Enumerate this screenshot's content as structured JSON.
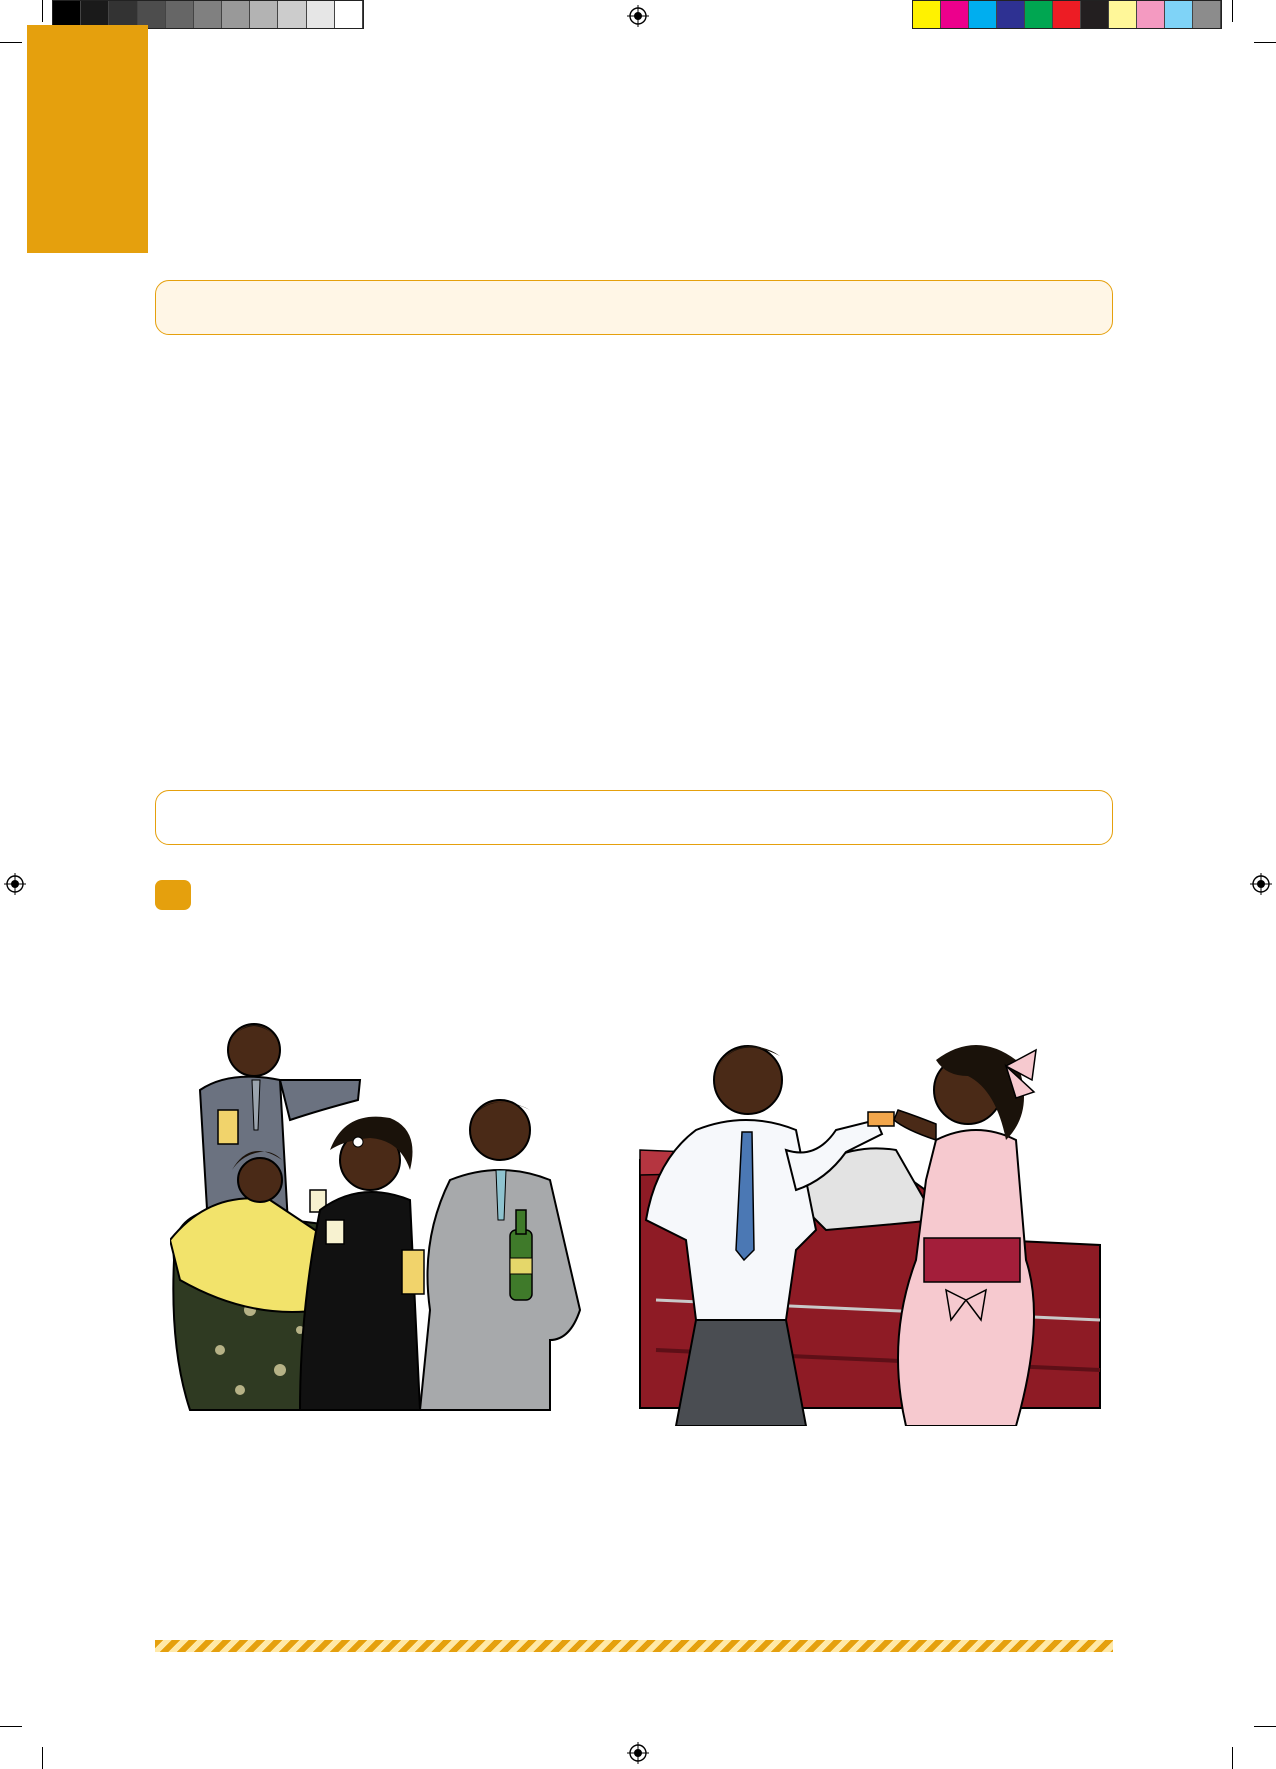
{
  "page": {
    "accent_color": "#E5A00D",
    "box_fill_color": "#FFF6E6"
  },
  "calibration": {
    "gray_swatches": [
      "#000000",
      "#1a1a1a",
      "#333333",
      "#4d4d4d",
      "#666666",
      "#808080",
      "#999999",
      "#b3b3b3",
      "#cccccc",
      "#e6e6e6",
      "#ffffff"
    ],
    "color_swatches": [
      "#FFF200",
      "#EC008C",
      "#00AEEF",
      "#2E3192",
      "#00A651",
      "#ED1C24",
      "#231F20",
      "#FFF799",
      "#F49AC1",
      "#7FD3F7",
      "#8C8C8C"
    ]
  },
  "icons": {
    "registration": "registration-mark-icon",
    "crop": "crop-mark-icon"
  },
  "illustrations": [
    {
      "id": "party-group",
      "icon": "party-drinking-illustration"
    },
    {
      "id": "couple-car",
      "icon": "couple-by-car-illustration"
    }
  ]
}
